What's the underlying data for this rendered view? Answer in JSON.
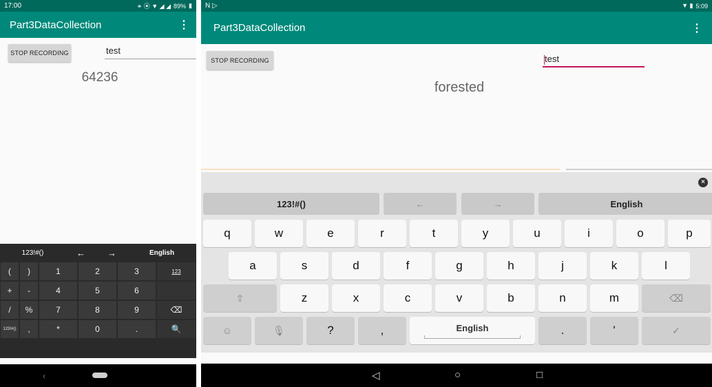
{
  "left": {
    "status": {
      "time": "17:00",
      "battery": "89%"
    },
    "app_title": "Part3DataCollection",
    "stop_button": "STOP RECORDING",
    "input_value": "test",
    "display_text": "64236",
    "keyboard": {
      "top": [
        "123!#()",
        "←",
        "→",
        "English"
      ],
      "rows": [
        [
          "(",
          ")",
          "1",
          "2",
          "3",
          "123"
        ],
        [
          "+",
          "-",
          "4",
          "5",
          "6",
          ""
        ],
        [
          "/",
          "%",
          "7",
          "8",
          "9",
          "⌫"
        ],
        [
          "123!#()",
          ",",
          "*",
          "0",
          ".",
          "🔍"
        ]
      ]
    },
    "nav": {
      "back": "‹"
    }
  },
  "right": {
    "status": {
      "time": "5:09"
    },
    "app_title": "Part3DataCollection",
    "stop_button": "STOP RECORDING",
    "input_value": "test",
    "display_text": "forested",
    "keyboard": {
      "top": [
        "123!#()",
        "←",
        "→",
        "English"
      ],
      "row1": [
        "q",
        "w",
        "e",
        "r",
        "t",
        "y",
        "u",
        "i",
        "o",
        "p"
      ],
      "row2": [
        "a",
        "s",
        "d",
        "f",
        "g",
        "h",
        "j",
        "k",
        "l"
      ],
      "row3": [
        "z",
        "x",
        "c",
        "v",
        "b",
        "n",
        "m"
      ],
      "row4_q": "?",
      "row4_comma": ",",
      "row4_space": "English",
      "row4_dot": ".",
      "row4_apos": "'"
    },
    "nav": {
      "back": "◁",
      "home": "○",
      "recent": "□"
    }
  },
  "colors": {
    "status": "#00695c",
    "appbar": "#00897b",
    "cursor": "#c2185b"
  }
}
